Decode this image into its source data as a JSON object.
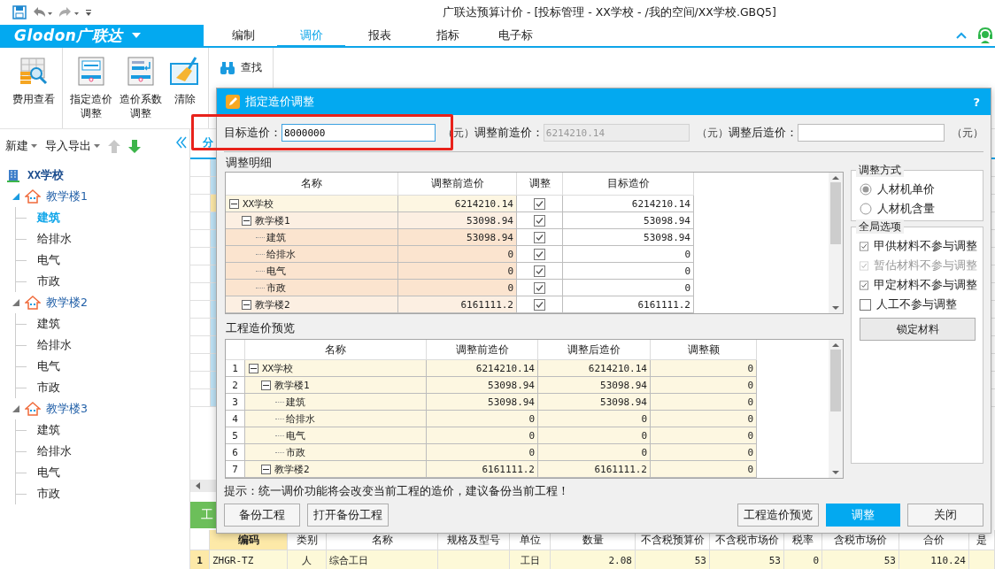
{
  "title_bar": {
    "title": "广联达预算计价 - [投标管理 - XX学校 - /我的空间/XX学校.GBQ5]"
  },
  "ribbon": {
    "logo": "Glodon广联达",
    "tabs": [
      {
        "label": "编制",
        "selected": false
      },
      {
        "label": "调价",
        "selected": true
      },
      {
        "label": "报表",
        "selected": false
      },
      {
        "label": "指标",
        "selected": false
      },
      {
        "label": "电子标",
        "selected": false
      }
    ],
    "groups": [
      [
        {
          "kind": "cost-view",
          "lines": [
            "费用查看"
          ]
        }
      ],
      [
        {
          "kind": "target-price",
          "lines": [
            "指定造价",
            "调整"
          ]
        },
        {
          "kind": "coefficient",
          "lines": [
            "造价系数",
            "调整"
          ]
        },
        {
          "kind": "clear",
          "lines": [
            "清除"
          ]
        }
      ]
    ],
    "find": "查找"
  },
  "sidebar": {
    "new": "新建",
    "import_export": "导入导出",
    "tree": {
      "label": "XX学校",
      "selected": false,
      "children": [
        {
          "label": "教学楼1",
          "expanded": true,
          "selected": false,
          "children": [
            {
              "label": "建筑",
              "selected": true
            },
            {
              "label": "给排水",
              "selected": false
            },
            {
              "label": "电气",
              "selected": false
            },
            {
              "label": "市政",
              "selected": false
            }
          ]
        },
        {
          "label": "教学楼2",
          "expanded": true,
          "selected": false,
          "children": [
            {
              "label": "建筑",
              "selected": false
            },
            {
              "label": "给排水",
              "selected": false
            },
            {
              "label": "电气",
              "selected": false
            },
            {
              "label": "市政",
              "selected": false
            }
          ]
        },
        {
          "label": "教学楼3",
          "expanded": true,
          "selected": false,
          "children": [
            {
              "label": "建筑",
              "selected": false
            },
            {
              "label": "给排水",
              "selected": false
            },
            {
              "label": "电气",
              "selected": false
            },
            {
              "label": "市政",
              "selected": false
            }
          ]
        }
      ]
    }
  },
  "main": {
    "tab_label": "分",
    "side_tab_label": "工",
    "table": {
      "columns": [
        "编码",
        "类别",
        "名称",
        "规格及型号",
        "单位",
        "数量",
        "不含税预算价",
        "不含税市场价",
        "税率",
        "含税市场价",
        "合价",
        "是"
      ],
      "rows": [
        {
          "no": "1",
          "cells": [
            "ZHGR-TZ",
            "人",
            "综合工日",
            "",
            "工日",
            "2.08",
            "53",
            "53",
            "0",
            "53",
            "110.24",
            ""
          ]
        }
      ]
    }
  },
  "dialog": {
    "title": "指定造价调整",
    "help": "?",
    "fields": [
      {
        "label": "目标造价：",
        "value": "8000000",
        "unit": "（元）",
        "focused": true,
        "disabled": false
      },
      {
        "label": "调整前造价：",
        "value": "6214210.14",
        "unit": "（元）",
        "focused": false,
        "disabled": true
      },
      {
        "label": "调整后造价：",
        "unit": "（元）",
        "focused": false,
        "disabled": false
      }
    ],
    "detail": {
      "title": "调整明细",
      "columns": [
        "名称",
        "调整前造价",
        "调整",
        "目标造价"
      ],
      "rows": [
        {
          "name": "XX学校",
          "before": "6214210.14",
          "adjust": true,
          "target": "6214210.14",
          "expanded": true,
          "children": [
            {
              "name": "教学楼1",
              "before": "53098.94",
              "adjust": true,
              "target": "53098.94",
              "expanded": true,
              "children": [
                {
                  "name": "建筑",
                  "before": "53098.94",
                  "adjust": true,
                  "target": "53098.94"
                },
                {
                  "name": "给排水",
                  "before": "0",
                  "adjust": true,
                  "target": "0"
                },
                {
                  "name": "电气",
                  "before": "0",
                  "adjust": true,
                  "target": "0"
                },
                {
                  "name": "市政",
                  "before": "0",
                  "adjust": true,
                  "target": "0"
                }
              ]
            },
            {
              "name": "教学楼2",
              "before": "6161111.2",
              "adjust": true,
              "target": "6161111.2",
              "expanded": true
            }
          ]
        }
      ]
    },
    "preview": {
      "title": "工程造价预览",
      "columns": [
        "名称",
        "调整前造价",
        "调整后造价",
        "调整额"
      ],
      "rows": [
        {
          "no": "1",
          "name": "XX学校",
          "before": "6214210.14",
          "after": "6214210.14",
          "amount": "0",
          "expanded": true,
          "children": [
            {
              "no": "2",
              "name": "教学楼1",
              "before": "53098.94",
              "after": "53098.94",
              "amount": "0",
              "expanded": true,
              "children": [
                {
                  "no": "3",
                  "name": "建筑",
                  "before": "53098.94",
                  "after": "53098.94",
                  "amount": "0"
                },
                {
                  "no": "4",
                  "name": "给排水",
                  "before": "0",
                  "after": "0",
                  "amount": "0"
                },
                {
                  "no": "5",
                  "name": "电气",
                  "before": "0",
                  "after": "0",
                  "amount": "0"
                },
                {
                  "no": "6",
                  "name": "市政",
                  "before": "0",
                  "after": "0",
                  "amount": "0"
                }
              ]
            },
            {
              "no": "7",
              "name": "教学楼2",
              "before": "6161111.2",
              "after": "6161111.2",
              "amount": "0",
              "expanded": true
            }
          ]
        }
      ]
    },
    "method": {
      "title": "调整方式",
      "options": [
        {
          "label": "人材机单价",
          "selected": true
        },
        {
          "label": "人材机含量",
          "selected": false
        }
      ]
    },
    "global_options": {
      "title": "全局选项",
      "options": [
        {
          "label": "甲供材料不参与调整",
          "checked": true,
          "disabled": false
        },
        {
          "label": "暂估材料不参与调整",
          "checked": true,
          "disabled": true
        },
        {
          "label": "甲定材料不参与调整",
          "checked": true,
          "disabled": false
        },
        {
          "label": "人工不参与调整",
          "checked": false,
          "disabled": false
        }
      ],
      "lock_button": "锁定材料"
    },
    "hint": "提示：统一调价功能将会改变当前工程的造价，建议备份当前工程！",
    "left_buttons": [
      "备份工程",
      "打开备份工程"
    ],
    "right_buttons": [
      {
        "label": "工程造价预览",
        "primary": false
      },
      {
        "label": "调整",
        "primary": true
      },
      {
        "label": "关闭",
        "primary": false
      }
    ]
  }
}
